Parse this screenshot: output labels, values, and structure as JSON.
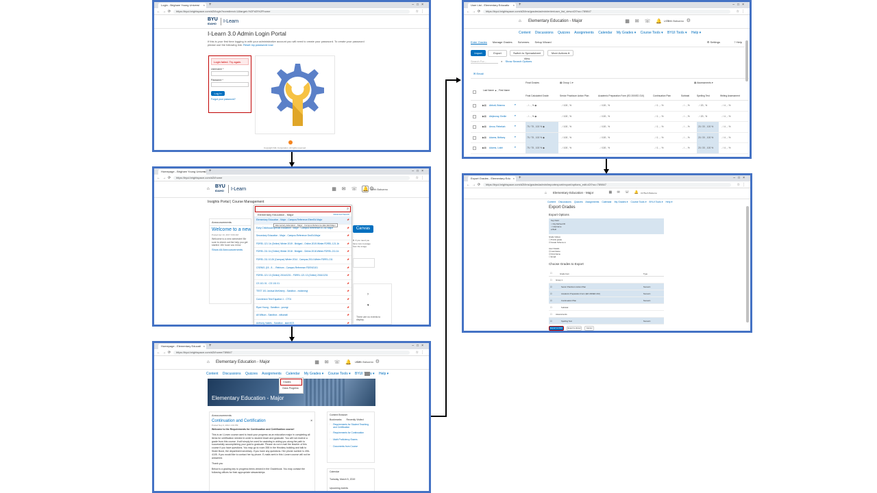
{
  "panel1": {
    "tab_title": "Login - Brigham Young Universi",
    "url": "https://byui.brightspace.com/d2l/login?noredirect=1&target=%2Fd2l%2Fhome",
    "logo_byu": "BYU",
    "logo_idaho": "IDAHO",
    "logo_ilearn": "I-Learn",
    "heading": "I-Learn 3.0 Admin Login Portal",
    "intro": "If this is your first time logging in with your administrative account you will need to create your password. To create your password please use the following link:",
    "reset_link": "Reset my password now",
    "error": "Login failed. Try again.",
    "username_label": "Username *",
    "password_label": "Password *",
    "login_button": "Log In",
    "forgot_link": "Forgot your password?",
    "copyright": "Copyright D2L Corporation. All rights reserved"
  },
  "panel2": {
    "tab_title": "Homepage - Brigham Young Universi",
    "url": "https://byui.brightspace.com/d2l/home",
    "logo_byu": "BYU",
    "logo_idaho": "IDAHO",
    "logo_ilearn": "I-Learn",
    "user_name": "Seth Balsamo",
    "nav": [
      "Insights Portal",
      "Course Management"
    ],
    "search_value": "Elementary Education - Major",
    "advanced_search": "Advanced Search",
    "results": [
      "Elementary Education - Major - Campus.Reference.ElemEd.Major",
      "Early Childhood/Special Education - Major - Campus.Reference.ECSE.Major",
      "Secondary Education - Major - Campus.Reference.SecEd.Major",
      "FDREL 121 1b (Online) Winter 2019 - Bridged - Online.2019.Winter.FDREL.121.1b",
      "FDREL 211 1b (Online) Winter 2018 - Bridged - Online.2018.Winter.FDREL.211.1b",
      "FDREL 211 10.26 (Campus) Winter 2014 - Campus.2014.Winter.FDREL.211",
      "CSEN01 (15 - 8 - - Rebirom - Campus.Reference.FDENG101",
      "FDREL 121 13 (Online) 2016/1231 - FDREL 121 13 (Online) 2016/1231",
      "CS 101 01 - CS 101 01",
      "TEST 101 Joshua McKinney - Sandbox - mckinneyj",
      "Conversion Test Equation 1 - CT01",
      "Ryan Young - Sandbox - youngr",
      "Ali Wilson - Sandbox - wilsonali",
      "Anthony Valdés - Sandbox - alarr4021"
    ],
    "tooltip": "Elementary Education - Major - Campus.Reference.ElemEd.Major",
    "announcements_label": "Announcements",
    "welcome_title": "Welcome to a new se",
    "posted": "Posted Apr 13, 2017 9:00 AM",
    "welcome_body": "Welcome to a new semester! Be sure to check out the help you get started. We hope you enjoy",
    "show_all": "Show All Announcements",
    "canvas_button": "Canvas",
    "side_note": "There are no events to display.",
    "right_text": "B. If you need you have new message from the image."
  },
  "panel3": {
    "tab_title": "Homepage - Elementary Educati",
    "url": "https://byui.brightspace.com/d2l/home/789847",
    "course": "Elementary Education - Major",
    "user_name": "Seth Balsamo",
    "user_role": "UCT",
    "nav": [
      "Content",
      "Discussions",
      "Quizzes",
      "Assignments",
      "Calendar",
      "My Grades ▾",
      "Course Tools ▾",
      "BYUI Tools ▾",
      "Help ▾"
    ],
    "dropdown": [
      "Grades",
      "Class Progress"
    ],
    "banner_title": "Elementary Education - Major",
    "announcements_label": "Announcements",
    "ann_title": "Continuation and Certification",
    "ann_posted": "Posted Sep 3, 2014 4:43 PM",
    "ann_welcome": "Welcome to the Requirements for Continuation and Certification course!",
    "ann_p1": "This is an I-Learn course used to track your progress as an education major in completing all items for certification needed in order to student teach and graduate. You will not receive a grade from this course. It will simply be used for assisting in aiding you along the path to successfully accomplishing your goal to graduate. Please do not e-mail the teacher of this course if you have questions. You may go to room 355 in the Hinckley building and talk to Sister Bond, the department secretary. If you have any questions. Her phone number is 496-4105. If you would like to contact her by phone. E-mails sent in this I-Learn course will not be answered.",
    "ann_thanks": "Thank you",
    "ann_p2": "Below is a grading key to progress items viewed in the Gradebook. You may contact the following offices for their appropriate stewardships",
    "content_browser": "Content Browser",
    "bookmarks": "Bookmarks",
    "recently_visited": "Recently Visited",
    "cb_items": [
      "Requirements for Student Teaching and Certification",
      "Requirements for Continuation",
      "Math Proficiency Exams",
      "Documents from Course"
    ],
    "calendar_label": "Calendar",
    "calendar_date": "Tuesday, March 5, 2019",
    "upcoming": "Upcoming events"
  },
  "panel4": {
    "tab_title": "User List - Elementary Educatio",
    "url": "https://byui.brightspace.com/d2l/lms/grades/admin/enter/user_list_view.d2l?ou=789847",
    "course": "Elementary Education - Major",
    "user_name": "Seth Balsamo",
    "user_role": "UCT",
    "nav": [
      "Content",
      "Discussions",
      "Quizzes",
      "Assignments",
      "Calendar",
      "My Grades ▾",
      "Course Tools ▾",
      "BYUI Tools ▾",
      "Help ▾"
    ],
    "tabs": [
      "Enter Grades",
      "Manage Grades",
      "Schemes",
      "Setup Wizard"
    ],
    "settings": "Settings",
    "help": "Help",
    "buttons": [
      "Import",
      "Export",
      "Switch to Spreadsheet View",
      "More Actions ▾"
    ],
    "search_placeholder": "Search For...",
    "show_search": "Show Search Options",
    "email": "Email",
    "col_final": "Final Grades",
    "col_group": "Group 1",
    "col_assess": "Assessments",
    "name_header": "Last Name ▲ , First Name",
    "sub_headers": [
      "Final Calculated Grade",
      "Senior Practicum Action Plan",
      "Academic Preparation Form (ED 200/ED 210)",
      "Continuation Plan",
      "Subtotal",
      "Spelling Test",
      "Writing Assessment"
    ],
    "rows": [
      {
        "name": "Abbott, Brianna",
        "final": "- / - , % ◆",
        "c1": "- / 100 , %",
        "c2": "- / 100 , %",
        "c3": "- / 1 , - %",
        "c4": "- / - , %",
        "c5": "- / 20 , %",
        "c6": "- / 4 , - %",
        "hl": false
      },
      {
        "name": "Alejeunay, Emilie",
        "final": "- / - , % ◆",
        "c1": "- / 100 , %",
        "c2": "- / 100 , %",
        "c3": "- / 1 , - %",
        "c4": "- / - , %",
        "c5": "- / 20 , %",
        "c6": "- / 4 , - %",
        "hl": false
      },
      {
        "name": "Arrow, Rebekah",
        "final": "75 / 75 , 100 % ◆",
        "c1": "- / 100 , %",
        "c2": "- / 100 , %",
        "c3": "- / 1 , - %",
        "c4": "- / - , %",
        "c5": "20 / 20 , 100 %",
        "c6": "- / 4 , - %",
        "hl": true
      },
      {
        "name": "Adams, Brittany",
        "final": "75 / 75 , 100 % ◆",
        "c1": "- / 100 , %",
        "c2": "- / 100 , %",
        "c3": "- / 1 , - %",
        "c4": "- / - , %",
        "c5": "20 / 20 , 100 %",
        "c6": "- / 4 , - %",
        "hl": true
      },
      {
        "name": "Adams, Lokiri",
        "final": "75 / 75 , 100 % ◆",
        "c1": "- / 100 , %",
        "c2": "- / 100 , %",
        "c3": "- / 1 , - %",
        "c4": "- / - , %",
        "c5": "20 / 20 , 100 %",
        "c6": "- / 4 , - %",
        "hl": true
      }
    ]
  },
  "panel5": {
    "tab_title": "Export Grades - Elementary Edu",
    "url": "https://byui.brightspace.com/d2l/lms/grades/admin/importexport/export/options_edit.d2l?ou=789847",
    "course": "Elementary Education - Major",
    "user_name": "Seth Balsamo",
    "user_role": "UCT",
    "nav": [
      "Content",
      "Discussions",
      "Quizzes",
      "Assignments",
      "Calendar",
      "My Grades ▾",
      "Course Tools ▾",
      "BYUI Tools ▾",
      "Help ▾"
    ],
    "title": "Export Grades",
    "options_title": "Export Options",
    "key_label": "Key Field",
    "key_options": [
      "Org Defined ID",
      "Username",
      "Both"
    ],
    "grade_values_label": "Grade Values",
    "grade_values": [
      "Points grade",
      "Grade Scheme"
    ],
    "user_details_label": "User Details",
    "user_details": [
      "Last Name",
      "First Name",
      "Email"
    ],
    "choose_title": "Choose Grades to Export",
    "grade_header": "Grade Item",
    "type_header": "Type",
    "grade_rows": [
      {
        "name": "Group 1",
        "type": "",
        "hl": false,
        "indent": 0
      },
      {
        "name": "Senior Practicum Action Plan",
        "type": "Numeric",
        "hl": true,
        "indent": 1
      },
      {
        "name": "Academic Preparation Form (ED 200/ED 210)",
        "type": "Numeric",
        "hl": true,
        "indent": 1
      },
      {
        "name": "Continuation Plan",
        "type": "Numeric",
        "hl": true,
        "indent": 1
      },
      {
        "name": "Subtotal",
        "type": "",
        "hl": false,
        "indent": 1
      },
      {
        "name": "Assessments",
        "type": "",
        "hl": false,
        "indent": 0
      },
      {
        "name": "Spelling Test",
        "type": "Numeric",
        "hl": true,
        "indent": 1
      }
    ],
    "footer_buttons": [
      "Export to CSV",
      "Export to Excel",
      "Cancel"
    ]
  }
}
